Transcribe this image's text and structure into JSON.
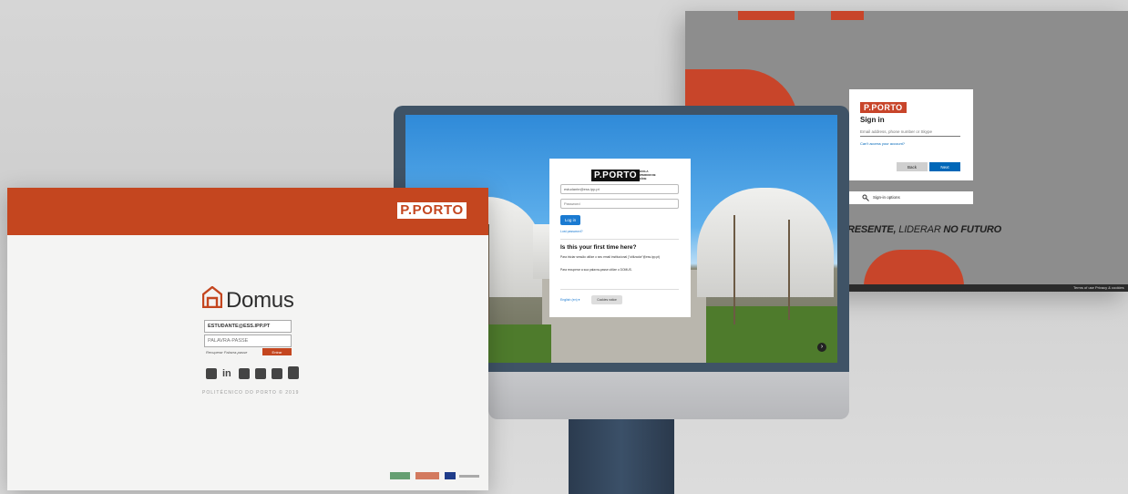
{
  "microsoft_signin": {
    "logo": "P.PORTO",
    "title": "Sign in",
    "email_placeholder": "Email address, phone number or Skype",
    "cant_access": "Can't access your account?",
    "back_label": "Back",
    "next_label": "Next",
    "signin_options": "Sign-in options",
    "slogan_part1": "RESENTE,",
    "slogan_part2": " LIDERAR ",
    "slogan_part3": "NO FUTURO",
    "footer_terms": "Terms of use",
    "footer_privacy": "Privacy & cookies"
  },
  "monitor_login": {
    "logo": "P.PORTO",
    "logo_sub": "ESCOLA SUPERIOR DE SAÚDE",
    "username_value": "estudante@ess.ipp.pt",
    "password_placeholder": "Password",
    "login_label": "Log in",
    "lost_password": "Lost password?",
    "first_time_heading": "Is this your first time here?",
    "info_line1": "Para iniciar sessão utilize o seu email institucional (\"utilizador\"@ess.ipp.pt)",
    "info_line2": "Para recuperar a sua palavra-passe utilize o DOMUS.",
    "language_label": "English (en) ▾",
    "cookies_label": "Cookies notice"
  },
  "domus_login": {
    "brand": "P.PORTO",
    "app_name": "Domus",
    "username_value": "ESTUDANTE@ESS.IPP.PT",
    "password_placeholder": "PALAVRA-PASSE",
    "recover_label": "Recuperar Palavra-passe",
    "enter_label": "Entrar",
    "copyright": "POLITÉCNICO DO PORTO © 2019",
    "social_icons": [
      "facebook-icon",
      "linkedin-icon",
      "twitter-icon",
      "flickr-icon",
      "instagram-icon",
      "youtube-icon"
    ]
  },
  "colors": {
    "porto_red": "#c4461f",
    "ms_blue": "#0067b8",
    "moodle_blue": "#1a7ad1",
    "imac_frame": "#3f5366"
  }
}
